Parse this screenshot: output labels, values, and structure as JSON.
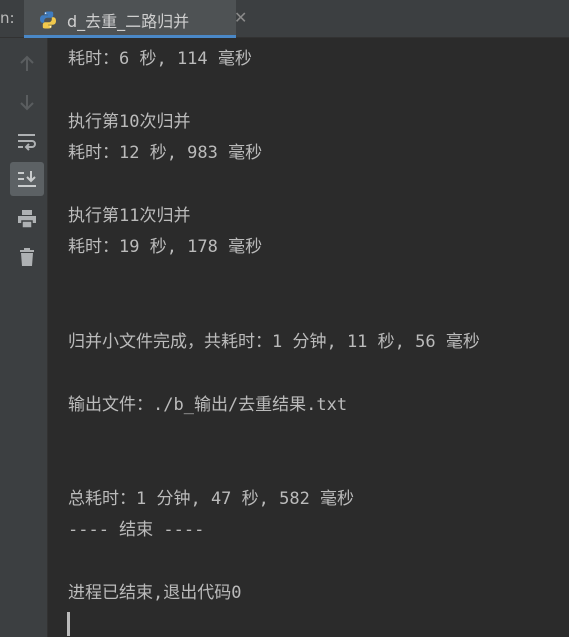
{
  "tab_bar": {
    "run_prefix": "n:",
    "tab_title": "d_去重_二路归并",
    "close_glyph": "✕",
    "active_indicator_color": "#4a88c7"
  },
  "toolbar": {
    "items": [
      {
        "name": "scroll-up-icon",
        "active": false
      },
      {
        "name": "scroll-down-icon",
        "active": false
      },
      {
        "name": "soft-wrap-icon",
        "active": false
      },
      {
        "name": "scroll-to-end-icon",
        "active": true
      },
      {
        "name": "print-icon",
        "active": false
      },
      {
        "name": "trash-icon",
        "active": false
      }
    ]
  },
  "console": {
    "lines": [
      "耗时：6 秒, 114 毫秒",
      "",
      "执行第10次归并",
      "耗时：12 秒, 983 毫秒",
      "",
      "执行第11次归并",
      "耗时：19 秒, 178 毫秒",
      "",
      "",
      "归并小文件完成，共耗时：1 分钟, 11 秒, 56 毫秒",
      "",
      "输出文件：./b_输出/去重结果.txt",
      "",
      "",
      "总耗时：1 分钟, 47 秒, 582 毫秒",
      "---- 结束 ----",
      "",
      "进程已结束,退出代码0"
    ]
  }
}
